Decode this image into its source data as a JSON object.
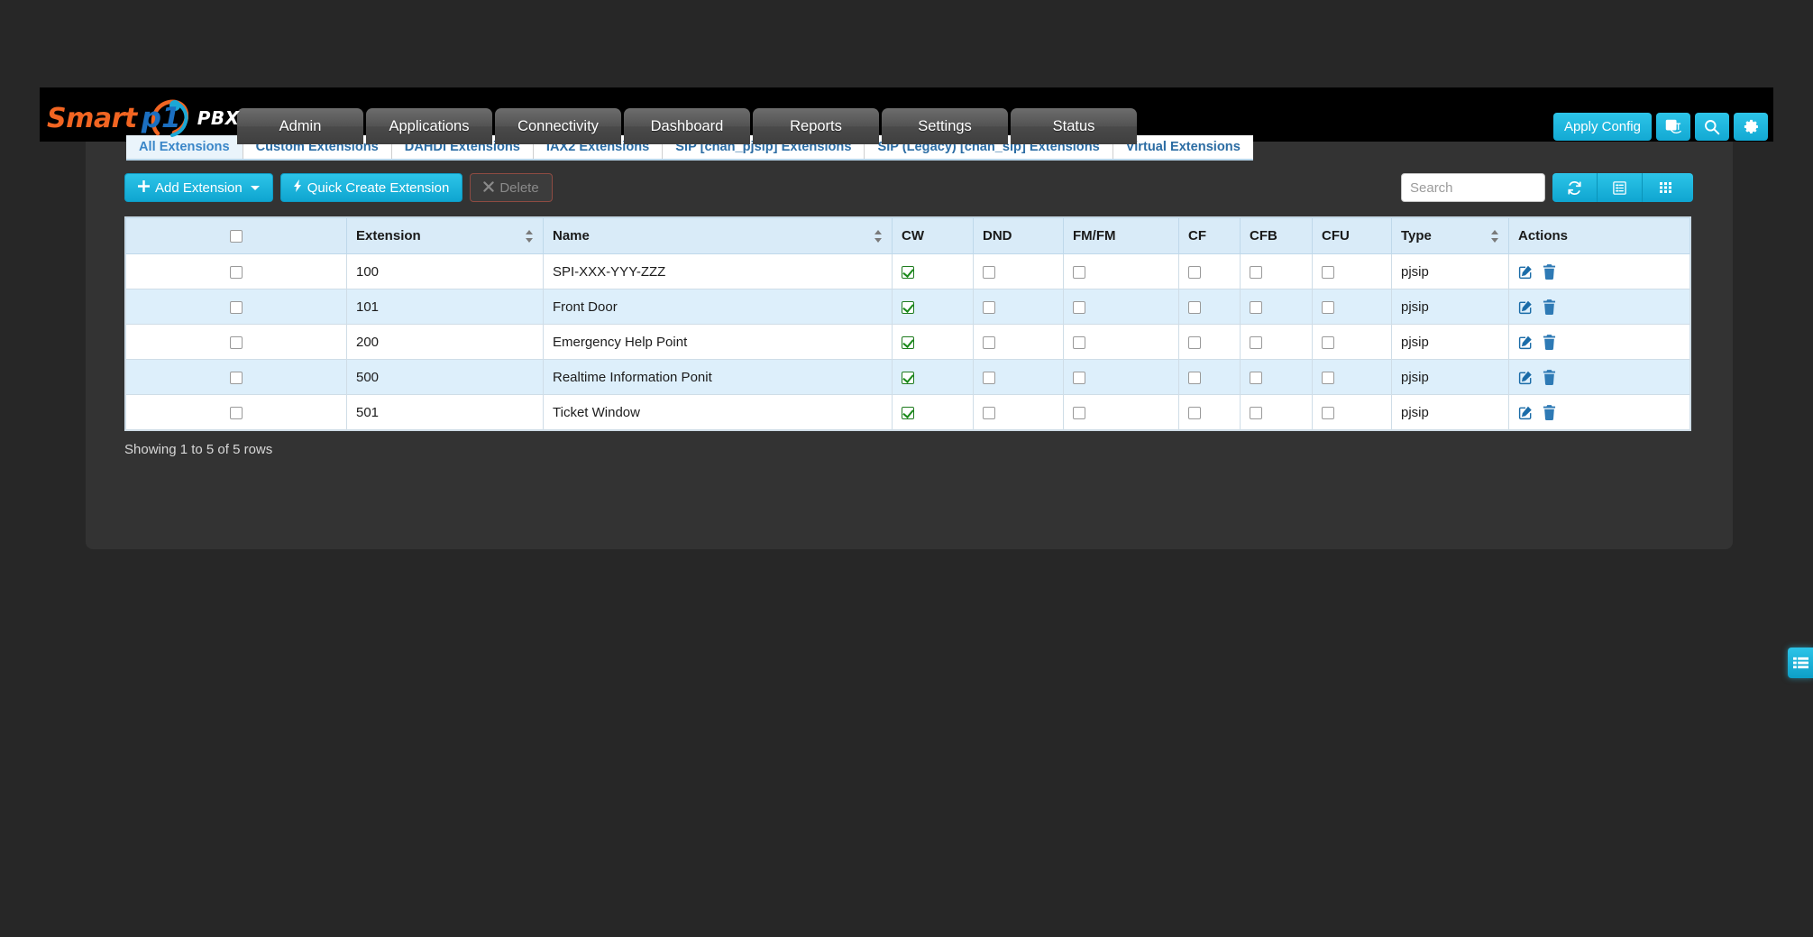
{
  "brand": {
    "name_part1": "Smart",
    "name_part2": "p1",
    "suffix": "PBX"
  },
  "header": {
    "nav_tabs": [
      {
        "label": "Admin"
      },
      {
        "label": "Applications"
      },
      {
        "label": "Connectivity"
      },
      {
        "label": "Dashboard"
      },
      {
        "label": "Reports"
      },
      {
        "label": "Settings"
      },
      {
        "label": "Status"
      }
    ],
    "apply_config_label": "Apply Config",
    "icons": {
      "translate": "translate-icon",
      "search": "search-icon",
      "gear": "gear-icon"
    }
  },
  "subnav": {
    "tabs": [
      {
        "label": "All Extensions",
        "active": true
      },
      {
        "label": "Custom Extensions",
        "active": false
      },
      {
        "label": "DAHDI Extensions",
        "active": false
      },
      {
        "label": "IAX2 Extensions",
        "active": false
      },
      {
        "label": "SIP [chan_pjsip] Extensions",
        "active": false
      },
      {
        "label": "SIP (Legacy) [chan_sip] Extensions",
        "active": false
      },
      {
        "label": "Virtual Extensions",
        "active": false
      }
    ]
  },
  "toolbar": {
    "add_extension_label": "Add Extension",
    "quick_create_label": "Quick Create Extension",
    "delete_label": "Delete",
    "delete_disabled": true,
    "search_placeholder": "Search",
    "search_value": "",
    "refresh_icon": "refresh-icon",
    "toggle_icon": "list-view-icon",
    "columns_icon": "columns-grid-icon"
  },
  "table": {
    "columns": [
      {
        "key": "chk",
        "label": "",
        "sortable": false
      },
      {
        "key": "extension",
        "label": "Extension",
        "sortable": true
      },
      {
        "key": "name",
        "label": "Name",
        "sortable": true
      },
      {
        "key": "cw",
        "label": "CW",
        "sortable": false
      },
      {
        "key": "dnd",
        "label": "DND",
        "sortable": false
      },
      {
        "key": "fmfm",
        "label": "FM/FM",
        "sortable": false
      },
      {
        "key": "cf",
        "label": "CF",
        "sortable": false
      },
      {
        "key": "cfb",
        "label": "CFB",
        "sortable": false
      },
      {
        "key": "cfu",
        "label": "CFU",
        "sortable": false
      },
      {
        "key": "type",
        "label": "Type",
        "sortable": true
      },
      {
        "key": "actions",
        "label": "Actions",
        "sortable": false
      }
    ],
    "rows": [
      {
        "selected": false,
        "extension": "100",
        "name": "SPI-XXX-YYY-ZZZ",
        "cw": true,
        "dnd": false,
        "fmfm": false,
        "cf": false,
        "cfb": false,
        "cfu": false,
        "type": "pjsip"
      },
      {
        "selected": false,
        "extension": "101",
        "name": "Front Door",
        "cw": true,
        "dnd": false,
        "fmfm": false,
        "cf": false,
        "cfb": false,
        "cfu": false,
        "type": "pjsip"
      },
      {
        "selected": false,
        "extension": "200",
        "name": "Emergency Help Point",
        "cw": true,
        "dnd": false,
        "fmfm": false,
        "cf": false,
        "cfb": false,
        "cfu": false,
        "type": "pjsip"
      },
      {
        "selected": false,
        "extension": "500",
        "name": "Realtime Information Ponit",
        "cw": true,
        "dnd": false,
        "fmfm": false,
        "cf": false,
        "cfb": false,
        "cfu": false,
        "type": "pjsip"
      },
      {
        "selected": false,
        "extension": "501",
        "name": "Ticket Window",
        "cw": true,
        "dnd": false,
        "fmfm": false,
        "cf": false,
        "cfb": false,
        "cfu": false,
        "type": "pjsip"
      }
    ],
    "row_actions": {
      "edit_icon": "edit-icon",
      "delete_icon": "trash-icon"
    }
  },
  "footer": {
    "showing_text": "Showing 1 to 5 of 5 rows"
  },
  "right_tab": {
    "icon": "list-panel-icon"
  },
  "colors": {
    "accent": "#2cc4e8",
    "brand_orange": "#F26522",
    "brand_blue": "#1B6FC1",
    "link_blue": "#2b6ca3",
    "row_alt": "#ddeffb",
    "header_row": "#d9ebf8",
    "page_bg": "#272727",
    "panel_bg": "#333333",
    "check_green": "#1a8a1a"
  }
}
